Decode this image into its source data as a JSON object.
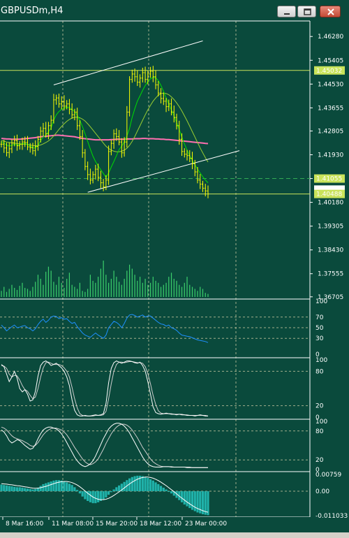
{
  "window": {
    "title": "GBPUSDm,H4",
    "buttons": [
      "minimize",
      "maximize",
      "close"
    ]
  },
  "colors": {
    "background": "#0a4a3c",
    "grid": "#c8c8a0",
    "separator": "#ffffff",
    "candle": "#ffff00",
    "volume": "#3cd06c",
    "ma_slow": "#ff6fb0",
    "ma_fast": "#00dd00",
    "ma_mid": "#9acd32",
    "channel": "#ffffff",
    "hline": "#c9e35a",
    "rsi": "#1e90ff",
    "stoch_main": "#ffffff",
    "macd_hist": "#20b2aa",
    "macd_signal": "#ffffff",
    "axis_text": "#ffffff",
    "label_box": "#c9e35a"
  },
  "chart_data": {
    "type": "candlestick",
    "symbol": "GBPUSDm",
    "timeframe": "H4",
    "title": "GBPUSDm,H4",
    "price_axis": {
      "ticks": [
        "1.46280",
        "1.45405",
        "1.44530",
        "1.43655",
        "1.42805",
        "1.41930",
        "1.41055",
        "1.40180",
        "1.39305",
        "1.38430",
        "1.37555",
        "1.36705"
      ],
      "ylim": [
        1.367,
        1.468
      ]
    },
    "labels": {
      "hline_upper": "1.45032",
      "hline_lower": "1.40488",
      "current_price": "1.40649",
      "dashed_level": "1.41055"
    },
    "time_axis": [
      "8 Mar 16:00",
      "11 Mar 08:00",
      "15 Mar 20:00",
      "18 Mar 12:00",
      "23 Mar 00:00"
    ],
    "closes": [
      1.4232,
      1.4218,
      1.4201,
      1.4215,
      1.4236,
      1.4245,
      1.4226,
      1.4231,
      1.424,
      1.4238,
      1.4222,
      1.4219,
      1.4208,
      1.4224,
      1.425,
      1.428,
      1.429,
      1.427,
      1.43,
      1.432,
      1.4395,
      1.4402,
      1.438,
      1.4388,
      1.4372,
      1.438,
      1.436,
      1.434,
      1.435,
      1.43,
      1.426,
      1.42,
      1.415,
      1.412,
      1.41,
      1.412,
      1.414,
      1.411,
      1.409,
      1.4075,
      1.41,
      1.4205,
      1.4235,
      1.427,
      1.426,
      1.424,
      1.42,
      1.424,
      1.435,
      1.447,
      1.449,
      1.448,
      1.446,
      1.4475,
      1.4495,
      1.447,
      1.449,
      1.45,
      1.448,
      1.445,
      1.442,
      1.44,
      1.439,
      1.437,
      1.438,
      1.435,
      1.433,
      1.43,
      1.425,
      1.4205,
      1.4195,
      1.419,
      1.418,
      1.416,
      1.413,
      1.41,
      1.4085,
      1.407,
      1.406,
      1.4049
    ],
    "ma_slow": [
      1.4253,
      1.4252,
      1.4251,
      1.4251,
      1.425,
      1.425,
      1.425,
      1.425,
      1.4251,
      1.4252,
      1.4253,
      1.4254,
      1.4255,
      1.4256,
      1.4258,
      1.4259,
      1.426,
      1.4261,
      1.4262,
      1.4263,
      1.4264,
      1.4265,
      1.4265,
      1.4264,
      1.4263,
      1.4262,
      1.4261,
      1.426,
      1.4259,
      1.4257,
      1.4255,
      1.4253,
      1.4252,
      1.4251,
      1.425,
      1.4249,
      1.4248,
      1.4248,
      1.4248,
      1.4248,
      1.4248,
      1.4248,
      1.4249,
      1.4249,
      1.425,
      1.425,
      1.425,
      1.425,
      1.4251,
      1.4251,
      1.4251,
      1.4252,
      1.4252,
      1.4252,
      1.4253,
      1.4253,
      1.4252,
      1.4252,
      1.4252,
      1.4251,
      1.4251,
      1.425,
      1.425,
      1.4249,
      1.4249,
      1.4248,
      1.4247,
      1.4246,
      1.4245,
      1.4244,
      1.4243,
      1.4242,
      1.4241,
      1.424,
      1.4239,
      1.4238,
      1.4237,
      1.4236,
      1.4235,
      1.4234
    ],
    "ma_fast": [
      1.424,
      1.4236,
      1.4228,
      1.4225,
      1.4228,
      1.4232,
      1.4228,
      1.423,
      1.4234,
      1.4235,
      1.423,
      1.4226,
      1.4218,
      1.4218,
      1.4228,
      1.4245,
      1.4258,
      1.4266,
      1.4278,
      1.4292,
      1.432,
      1.434,
      1.4352,
      1.436,
      1.4365,
      1.4368,
      1.4366,
      1.436,
      1.4352,
      1.4338,
      1.432,
      1.4296,
      1.427,
      1.4242,
      1.4214,
      1.4188,
      1.4168,
      1.4152,
      1.4138,
      1.4124,
      1.411,
      1.4126,
      1.4148,
      1.4168,
      1.419,
      1.4212,
      1.4225,
      1.424,
      1.4262,
      1.429,
      1.433,
      1.4362,
      1.439,
      1.441,
      1.443,
      1.4448,
      1.4462,
      1.4472,
      1.4478,
      1.4476,
      1.4466,
      1.4448,
      1.4426,
      1.4402,
      1.438,
      1.4358,
      1.4336,
      1.4312,
      1.4286,
      1.4258,
      1.4232,
      1.421,
      1.419,
      1.4172,
      1.4156,
      1.414,
      1.4126,
      1.4112,
      1.41,
      1.409
    ],
    "ma_mid": [
      1.4245,
      1.4243,
      1.424,
      1.4238,
      1.4237,
      1.4236,
      1.4234,
      1.4233,
      1.4232,
      1.4232,
      1.4231,
      1.4229,
      1.4227,
      1.4226,
      1.4227,
      1.4229,
      1.4233,
      1.4238,
      1.4244,
      1.4252,
      1.4262,
      1.4274,
      1.4286,
      1.4297,
      1.4307,
      1.4316,
      1.4323,
      1.4328,
      1.4331,
      1.4331,
      1.4329,
      1.4324,
      1.4317,
      1.4307,
      1.4296,
      1.4284,
      1.4272,
      1.426,
      1.4248,
      1.4236,
      1.4224,
      1.4216,
      1.421,
      1.4206,
      1.4204,
      1.4204,
      1.4206,
      1.421,
      1.4217,
      1.4228,
      1.4242,
      1.426,
      1.428,
      1.43,
      1.432,
      1.434,
      1.4358,
      1.4375,
      1.439,
      1.4402,
      1.4412,
      1.4418,
      1.442,
      1.4418,
      1.4414,
      1.4406,
      1.4396,
      1.4384,
      1.437,
      1.4354,
      1.4336,
      1.4318,
      1.4298,
      1.4278,
      1.4258,
      1.4238,
      1.4218,
      1.42,
      1.4182,
      1.4166
    ],
    "channel": {
      "upper": [
        [
          20,
          1.445
        ],
        [
          77,
          1.4612
        ]
      ],
      "lower": [
        [
          33,
          1.4055
        ],
        [
          91,
          1.4208
        ]
      ]
    },
    "volume": [
      6,
      10,
      5,
      8,
      12,
      9,
      7,
      11,
      14,
      9,
      8,
      6,
      10,
      15,
      22,
      18,
      12,
      25,
      30,
      26,
      15,
      12,
      20,
      14,
      9,
      18,
      24,
      12,
      10,
      8,
      14,
      6,
      5,
      8,
      22,
      16,
      14,
      20,
      28,
      36,
      22,
      14,
      18,
      26,
      20,
      15,
      12,
      18,
      26,
      32,
      28,
      22,
      16,
      20,
      14,
      18,
      12,
      14,
      20,
      16,
      14,
      10,
      12,
      14,
      20,
      24,
      18,
      16,
      12,
      10,
      14,
      20,
      12,
      10,
      8,
      6,
      10,
      8,
      4,
      3
    ],
    "rsi": {
      "levels_axis": [
        "100",
        "70",
        "50",
        "30",
        "0"
      ],
      "values": [
        55,
        50,
        44,
        48,
        52,
        55,
        50,
        51,
        53,
        54,
        50,
        48,
        44,
        48,
        56,
        62,
        66,
        60,
        64,
        70,
        72,
        71,
        67,
        69,
        66,
        67,
        62,
        58,
        60,
        52,
        46,
        40,
        36,
        34,
        32,
        36,
        40,
        36,
        33,
        30,
        36,
        50,
        56,
        62,
        60,
        56,
        50,
        58,
        68,
        74,
        75,
        73,
        70,
        72,
        74,
        70,
        72,
        72,
        68,
        64,
        60,
        57,
        56,
        53,
        55,
        50,
        48,
        45,
        40,
        36,
        35,
        34,
        33,
        31,
        29,
        27,
        26,
        25,
        24,
        22
      ]
    },
    "stochastic_1": {
      "levels_axis": [
        "100",
        "80",
        "20",
        "0"
      ],
      "main": [
        92,
        88,
        75,
        62,
        70,
        80,
        68,
        50,
        44,
        48,
        40,
        28,
        30,
        45,
        72,
        90,
        96,
        98,
        95,
        90,
        92,
        94,
        90,
        86,
        80,
        70,
        55,
        30,
        12,
        4,
        2,
        2,
        3,
        2,
        2,
        3,
        4,
        3,
        4,
        6,
        24,
        60,
        85,
        95,
        98,
        96,
        94,
        96,
        98,
        98,
        97,
        95,
        94,
        96,
        90,
        80,
        62,
        40,
        18,
        8,
        6,
        5,
        6,
        7,
        6,
        5,
        5,
        4,
        5,
        4,
        4,
        3,
        3,
        3,
        2,
        3,
        4,
        3,
        2,
        2
      ],
      "signal": [
        90,
        89,
        85,
        75,
        70,
        73,
        72,
        65,
        55,
        48,
        45,
        38,
        32,
        35,
        50,
        70,
        86,
        95,
        96,
        94,
        92,
        92,
        92,
        90,
        86,
        80,
        70,
        52,
        32,
        16,
        6,
        3,
        2,
        2,
        2,
        2,
        3,
        3,
        3,
        4,
        10,
        32,
        58,
        80,
        92,
        96,
        96,
        95,
        96,
        97,
        97,
        96,
        95,
        95,
        94,
        88,
        76,
        58,
        38,
        22,
        11,
        7,
        6,
        6,
        6,
        6,
        5,
        5,
        5,
        5,
        4,
        4,
        3,
        3,
        3,
        3,
        3,
        3,
        3,
        2
      ]
    },
    "stochastic_2": {
      "levels_axis": [
        "100",
        "80",
        "20",
        "0"
      ],
      "main": [
        82,
        78,
        70,
        60,
        55,
        58,
        62,
        60,
        55,
        50,
        46,
        42,
        44,
        52,
        64,
        74,
        82,
        86,
        88,
        88,
        86,
        84,
        80,
        74,
        66,
        56,
        46,
        36,
        26,
        18,
        12,
        8,
        6,
        8,
        12,
        18,
        28,
        40,
        52,
        64,
        74,
        84,
        90,
        94,
        96,
        96,
        94,
        90,
        84,
        76,
        66,
        56,
        46,
        36,
        26,
        18,
        12,
        8,
        6,
        5,
        5,
        5,
        6,
        6,
        6,
        5,
        5,
        5,
        5,
        5,
        5,
        4,
        4,
        4,
        4,
        4,
        4,
        4,
        4,
        4
      ],
      "signal": [
        88,
        86,
        82,
        76,
        70,
        66,
        64,
        62,
        60,
        57,
        54,
        50,
        48,
        50,
        56,
        64,
        72,
        78,
        82,
        85,
        86,
        86,
        84,
        82,
        78,
        72,
        64,
        55,
        46,
        38,
        30,
        22,
        16,
        12,
        10,
        12,
        16,
        22,
        32,
        42,
        54,
        64,
        74,
        82,
        88,
        92,
        94,
        94,
        92,
        88,
        82,
        74,
        66,
        56,
        46,
        38,
        30,
        22,
        16,
        12,
        9,
        7,
        6,
        6,
        6,
        6,
        5,
        5,
        5,
        5,
        5,
        5,
        5,
        4,
        4,
        4,
        4,
        4,
        4,
        4
      ]
    },
    "macd": {
      "levels_axis": [
        "0.00759",
        "0.00",
        "-0.011033"
      ],
      "ylim": [
        -0.011033,
        0.00759
      ],
      "histogram": [
        0.003,
        0.0028,
        0.0026,
        0.0024,
        0.0022,
        0.002,
        0.0018,
        0.0018,
        0.0016,
        0.0014,
        0.0012,
        0.001,
        0.0008,
        0.001,
        0.0016,
        0.0024,
        0.0032,
        0.0036,
        0.004,
        0.0044,
        0.0048,
        0.005,
        0.005,
        0.0048,
        0.0044,
        0.004,
        0.0034,
        0.0028,
        0.0018,
        0.0006,
        -0.001,
        -0.0024,
        -0.0036,
        -0.0044,
        -0.005,
        -0.0054,
        -0.0054,
        -0.005,
        -0.0044,
        -0.0036,
        -0.0028,
        -0.0016,
        -0.0004,
        0.0008,
        0.0018,
        0.0026,
        0.0034,
        0.0042,
        0.005,
        0.0058,
        0.0064,
        0.0068,
        0.007,
        0.007,
        0.0068,
        0.0064,
        0.006,
        0.0054,
        0.0048,
        0.004,
        0.0032,
        0.0024,
        0.0016,
        0.0008,
        0.0,
        -0.001,
        -0.002,
        -0.003,
        -0.004,
        -0.005,
        -0.006,
        -0.0068,
        -0.0076,
        -0.0084,
        -0.009,
        -0.0096,
        -0.01,
        -0.0104,
        -0.0106,
        -0.0108
      ],
      "signal": [
        0.0034,
        0.0033,
        0.0032,
        0.003,
        0.0029,
        0.0027,
        0.0025,
        0.0024,
        0.0022,
        0.002,
        0.0018,
        0.0016,
        0.0014,
        0.0013,
        0.0014,
        0.0016,
        0.0019,
        0.0022,
        0.0026,
        0.003,
        0.0034,
        0.0038,
        0.0041,
        0.0043,
        0.0044,
        0.0044,
        0.0042,
        0.0039,
        0.0034,
        0.0028,
        0.002,
        0.0011,
        0.0001,
        -0.0009,
        -0.0018,
        -0.0026,
        -0.0032,
        -0.0036,
        -0.0038,
        -0.0038,
        -0.0036,
        -0.0032,
        -0.0026,
        -0.0019,
        -0.0011,
        -0.0003,
        0.0006,
        0.0015,
        0.0024,
        0.0033,
        0.0041,
        0.0048,
        0.0054,
        0.0059,
        0.0062,
        0.0064,
        0.0064,
        0.0062,
        0.0059,
        0.0054,
        0.0048,
        0.0041,
        0.0033,
        0.0025,
        0.0016,
        0.0007,
        -0.0002,
        -0.0012,
        -0.0022,
        -0.0031,
        -0.004,
        -0.0049,
        -0.0057,
        -0.0065,
        -0.0072,
        -0.0078,
        -0.0083,
        -0.0088,
        -0.0092,
        -0.0095
      ]
    }
  }
}
